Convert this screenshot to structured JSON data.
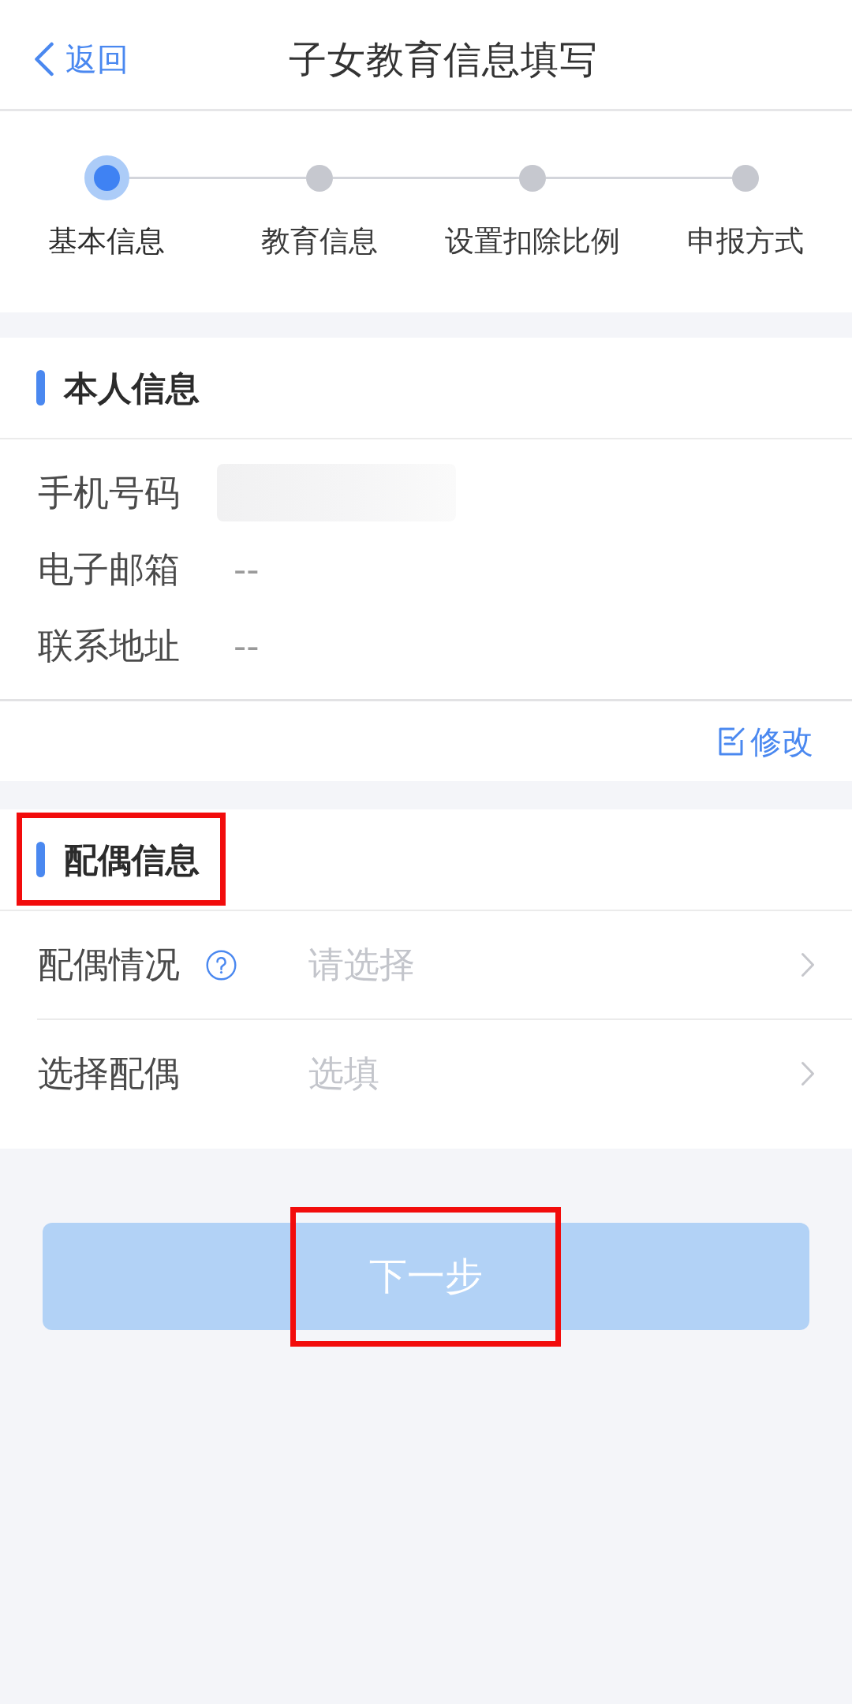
{
  "header": {
    "back": "返回",
    "title": "子女教育信息填写"
  },
  "steps": [
    {
      "label": "基本信息",
      "selected": true
    },
    {
      "label": "教育信息",
      "selected": false
    },
    {
      "label": "设置扣除比例",
      "selected": false
    },
    {
      "label": "申报方式",
      "selected": false
    }
  ],
  "sections": [
    {
      "kind": "info",
      "title": "本人信息",
      "highlighted": false,
      "rows": [
        {
          "label": "手机号码",
          "redacted": true
        },
        {
          "label": "电子邮箱",
          "value": "--",
          "redacted": false
        },
        {
          "label": "联系地址",
          "value": "--",
          "redacted": false
        }
      ],
      "action": "修改"
    },
    {
      "kind": "picker",
      "title": "配偶信息",
      "highlighted": true,
      "rows": [
        {
          "label": "配偶情况",
          "placeholder": "请选择",
          "help": true
        },
        {
          "label": "选择配偶",
          "placeholder": "选填",
          "help": false
        }
      ]
    }
  ],
  "next_button": {
    "label": "下一步",
    "disabled": true,
    "highlighted": true
  }
}
